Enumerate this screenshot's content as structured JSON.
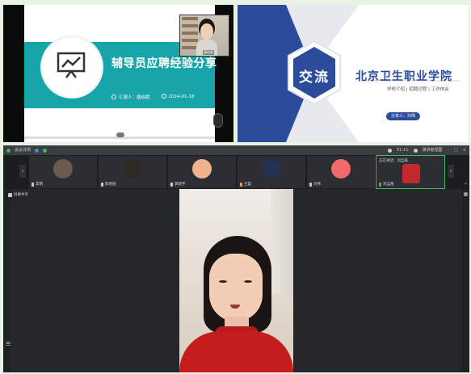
{
  "slide_left": {
    "title": "辅导员应聘经验分享",
    "reporter": "汇报人：唐启妮",
    "date": "2024-01-18",
    "self_cam_name": "唐启妮"
  },
  "slide_right": {
    "badge": "交流",
    "school": "北京卫生职业学院",
    "subtitle": "学校介绍 | 招聘过程 | 工作体会",
    "sharer": "分享人：刘伟"
  },
  "meeting": {
    "title": "会议详情",
    "time": "51:11",
    "view_label": "演讲者视图",
    "share_label": "屏幕共享",
    "participants": [
      {
        "name": "李明",
        "avatar_color": "#6b5a4e"
      },
      {
        "name": "陈晓丽",
        "avatar_color": "#2d2a26"
      },
      {
        "name": "郭晓宇",
        "avatar_color": "#f2b28f"
      },
      {
        "name": "王磊",
        "avatar_color": "#22324f"
      },
      {
        "name": "刘伟",
        "avatar_color": "#f26a6a"
      },
      {
        "name": "刘孟皓",
        "avatar_color": "#c12a2a"
      }
    ],
    "speaking_label": "正在讲话：刘孟皓"
  },
  "colors": {
    "accent_teal": "#18a5a9",
    "accent_blue": "#2b4c9a",
    "active_green": "#3bb85a"
  }
}
